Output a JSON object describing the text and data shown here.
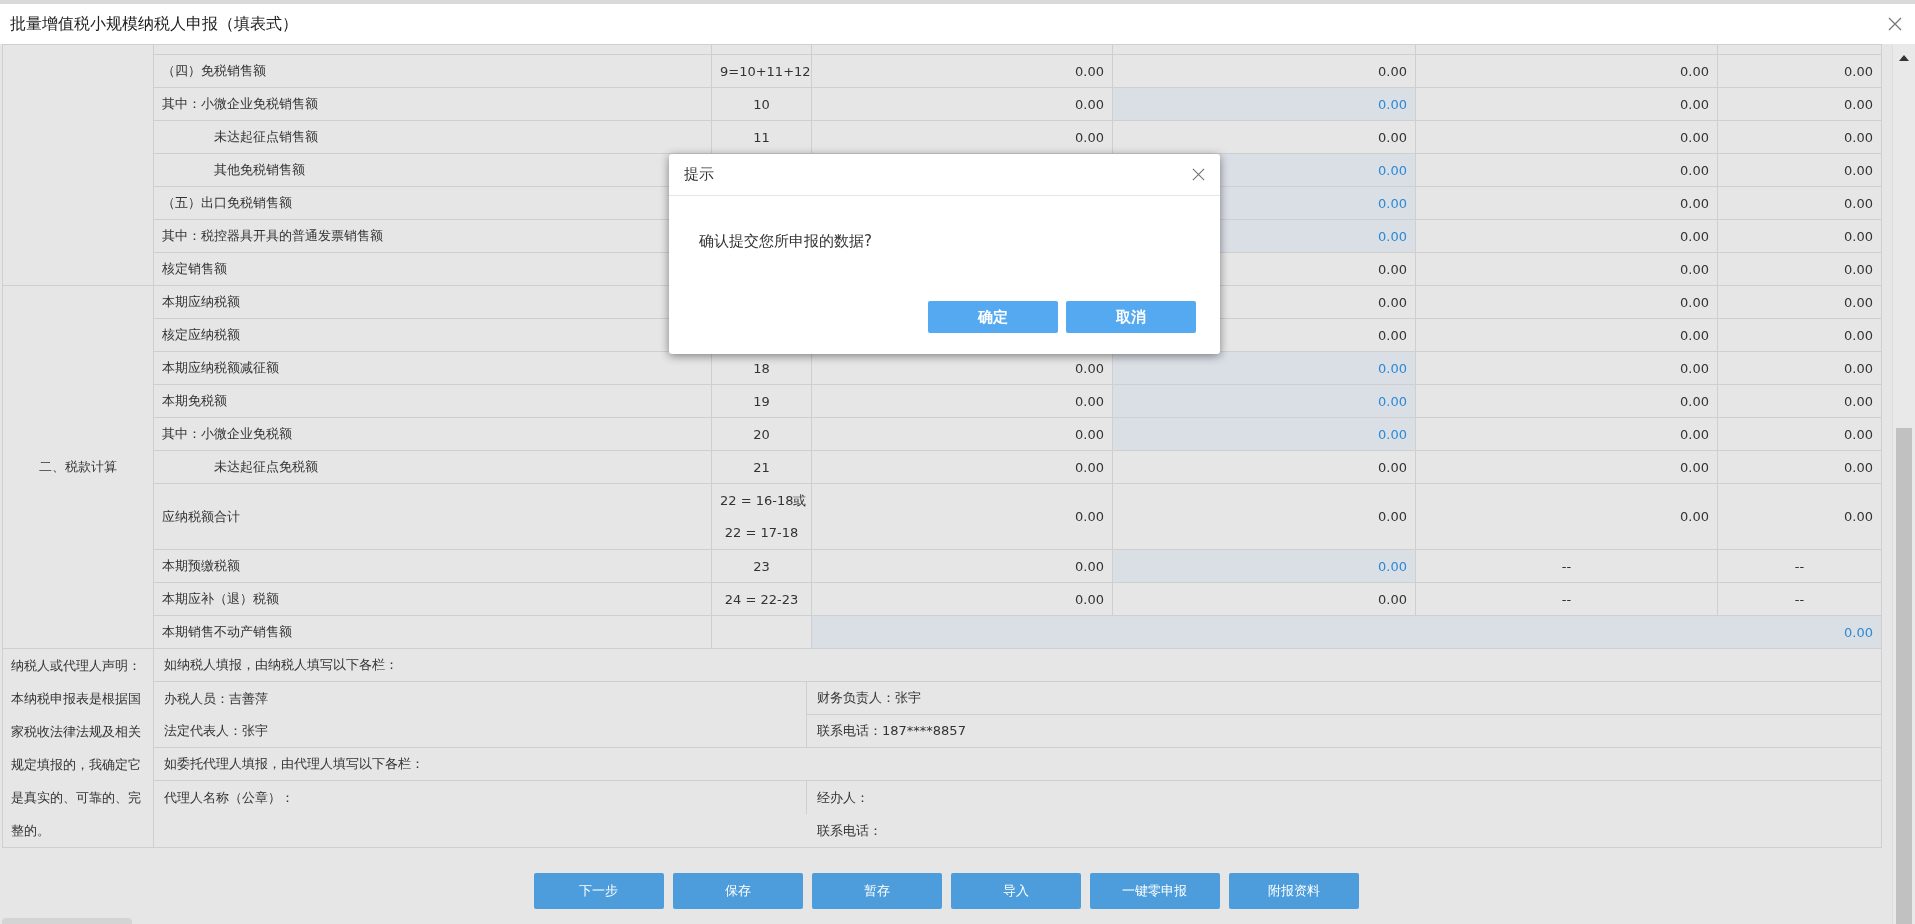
{
  "window": {
    "title": "批量增值税小规模纳税人申报（填表式）"
  },
  "table": {
    "sections": [
      {
        "rows": [
          {
            "kind": "clipped"
          },
          {
            "kind": "main",
            "label": "（四）免税销售额",
            "line": "9=10+11+12",
            "values": [
              "0.00",
              "0.00",
              "0.00",
              "0.00"
            ],
            "editable": false
          },
          {
            "kind": "main",
            "label": "其中：小微企业免税销售额",
            "line": "10",
            "values": [
              "0.00",
              "0.00",
              "0.00",
              "0.00"
            ],
            "editable": true
          },
          {
            "kind": "sub",
            "label": "未达起征点销售额",
            "line": "11",
            "values": [
              "0.00",
              "0.00",
              "0.00",
              "0.00"
            ],
            "editable": false
          },
          {
            "kind": "sub",
            "label": "其他免税销售额",
            "values": [
              "0.00",
              "0.00",
              "0.00"
            ],
            "editable": true
          },
          {
            "kind": "main",
            "label": "（五）出口免税销售额",
            "values": [
              "0.00",
              "0.00",
              "0.00"
            ],
            "editable": true
          },
          {
            "kind": "main",
            "label": "其中：税控器具开具的普通发票销售额",
            "values": [
              "0.00",
              "0.00",
              "0.00"
            ],
            "editable": true
          },
          {
            "kind": "main",
            "label": "核定销售额",
            "values": [
              "0.00",
              "0.00",
              "0.00"
            ],
            "editable": false
          }
        ]
      },
      {
        "label": "二、税款计算",
        "rows": [
          {
            "kind": "main",
            "label": "本期应纳税额",
            "values": [
              "0.00",
              "0.00",
              "0.00"
            ],
            "editable": false
          },
          {
            "kind": "main",
            "label": "核定应纳税额",
            "values": [
              "0.00",
              "0.00",
              "0.00"
            ],
            "editable": false
          },
          {
            "kind": "main",
            "label": "本期应纳税额减征额",
            "line": "18",
            "values": [
              "0.00",
              "0.00",
              "0.00",
              "0.00"
            ],
            "editable": true
          },
          {
            "kind": "main",
            "label": "本期免税额",
            "line": "19",
            "values": [
              "0.00",
              "0.00",
              "0.00",
              "0.00"
            ],
            "editable": true
          },
          {
            "kind": "main",
            "label": "其中：小微企业免税额",
            "line": "20",
            "values": [
              "0.00",
              "0.00",
              "0.00",
              "0.00"
            ],
            "editable": true
          },
          {
            "kind": "sub",
            "label": "未达起征点免税额",
            "line": "21",
            "values": [
              "0.00",
              "0.00",
              "0.00",
              "0.00"
            ],
            "editable": false
          },
          {
            "kind": "main",
            "label": "应纳税额合计",
            "line": [
              "22 = 16-18或",
              "22 = 17-18"
            ],
            "values": [
              "0.00",
              "0.00",
              "0.00",
              "0.00"
            ],
            "editable": false
          },
          {
            "kind": "main",
            "label": "本期预缴税额",
            "line": "23",
            "values": [
              "0.00",
              "0.00",
              "--",
              "--"
            ],
            "editable": true
          },
          {
            "kind": "main",
            "label": "本期应补（退）税额",
            "line": "24 = 22-23",
            "values": [
              "0.00",
              "0.00",
              "--",
              "--"
            ],
            "editable": false
          },
          {
            "kind": "total",
            "label": "本期销售不动产销售额",
            "value": "0.00",
            "editable": true
          }
        ]
      }
    ]
  },
  "declaration": {
    "title": "纳税人或代理人声明：",
    "body": "本纳税申报表是根据国家税收法律法规及相关规定填报的，我确定它是真实的、可靠的、完整的。",
    "taxpayer_heading": "如纳税人填报，由纳税人填写以下各栏：",
    "taxpayer_fields": [
      [
        "办税人员：吉善萍",
        "财务负责人：张宇"
      ],
      [
        "法定代表人：张宇",
        "联系电话：187****8857"
      ]
    ],
    "agent_heading": "如委托代理人填报，由代理人填写以下各栏：",
    "agent_name": "代理人名称（公章）：",
    "agent_fields": [
      "经办人：",
      "联系电话："
    ]
  },
  "buttons": [
    "下一步",
    "保存",
    "暂存",
    "导入",
    "一键零申报",
    "附报资料"
  ],
  "dialog": {
    "title": "提示",
    "message": "确认提交您所申报的数据?",
    "buttons": [
      "确定",
      "取消"
    ]
  }
}
